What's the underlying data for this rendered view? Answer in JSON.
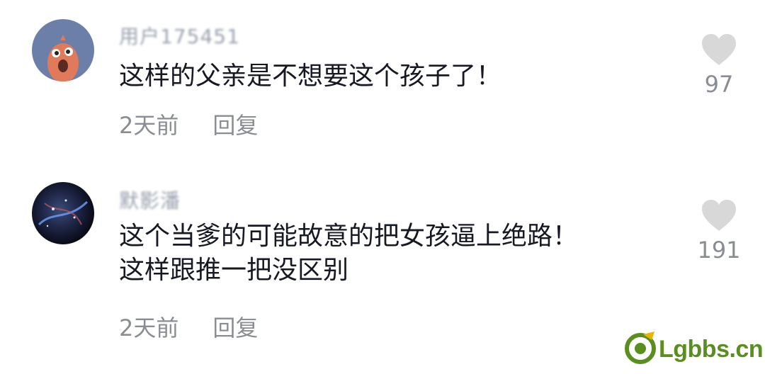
{
  "comments": [
    {
      "username": "用户175451",
      "text": "这样的父亲是不想要这个孩子了！",
      "time": "2天前",
      "reply": "回复",
      "likes": "97",
      "avatar_icon": "cartoon-face-icon"
    },
    {
      "username": "默影潘",
      "text_lines": [
        "这个当爹的可能故意的把女孩逼上绝路！",
        "这样跟推一把没区别"
      ],
      "time": "2天前",
      "reply": "回复",
      "likes": "191",
      "avatar_icon": "galaxy-planet-icon"
    }
  ],
  "watermark": {
    "text": "Lgbbs.cn",
    "color": "#5a8f1f"
  },
  "colors": {
    "text": "#161823",
    "meta": "#8a8d96",
    "heart": "#d8d8d8"
  }
}
